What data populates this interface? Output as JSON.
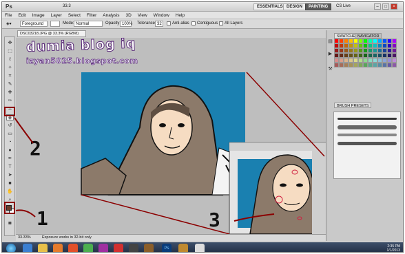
{
  "app": {
    "logo": "Ps",
    "zoom": "33.3",
    "workspaces": [
      "ESSENTIALS",
      "DESIGN",
      "PAINTING"
    ],
    "active_workspace": "PAINTING",
    "cs_live": "CS Live"
  },
  "menu": [
    "File",
    "Edit",
    "Image",
    "Layer",
    "Select",
    "Filter",
    "Analysis",
    "3D",
    "View",
    "Window",
    "Help"
  ],
  "options": {
    "fill_source": "Foreground",
    "mode_label": "Mode:",
    "mode_value": "Normal",
    "opacity_label": "Opacity:",
    "opacity_value": "100%",
    "tolerance_label": "Tolerance:",
    "tolerance_value": "32",
    "anti_alias": "Anti-alias",
    "contiguous": "Contiguous",
    "all_layers": "All Layers"
  },
  "document": {
    "tab": "DSC03218.JPG @ 33.3% (RGB/8)",
    "zoom_status": "33.33%",
    "status_msg": "Exposure works in 32-bit only"
  },
  "watermark": {
    "line1": "dumia blog iq",
    "line2": "izyan5025.blogspot.com"
  },
  "panels": {
    "swatches": "SWATCHES",
    "navigator": "NAVIGATOR",
    "brush_presets": "BRUSH PRESETS"
  },
  "annotations": [
    "1",
    "2",
    "3"
  ],
  "taskbar": {
    "time": "2:35 PM",
    "date": "1/1/2013"
  }
}
